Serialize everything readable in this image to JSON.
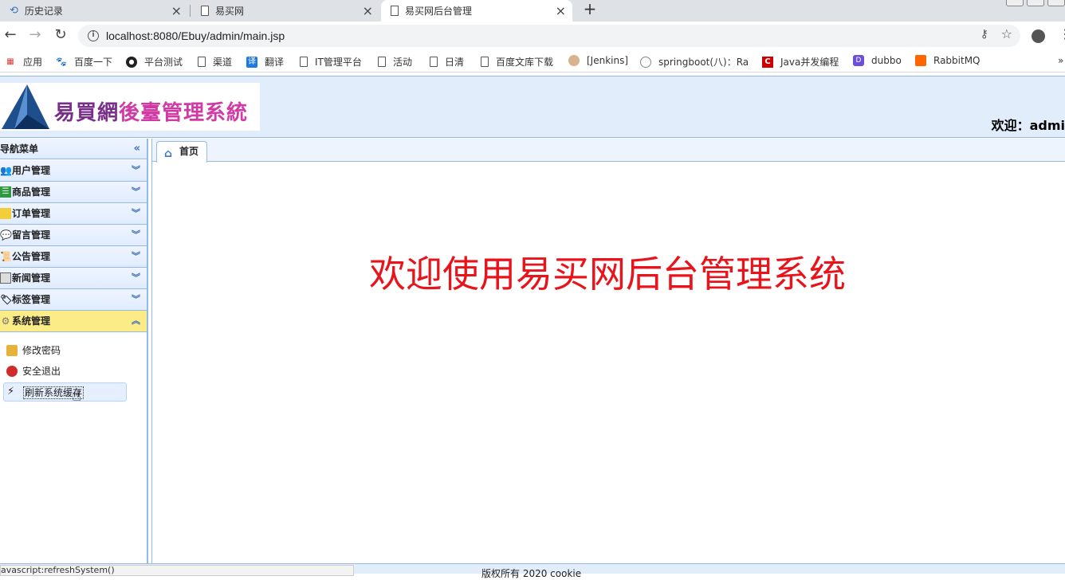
{
  "browser": {
    "tabs": [
      {
        "title": "历史记录",
        "icon": "history-icon"
      },
      {
        "title": "易买网",
        "icon": "document-icon"
      },
      {
        "title": "易买网后台管理",
        "icon": "document-icon",
        "active": true
      }
    ],
    "url": "localhost:8080/Ebuy/admin/main.jsp",
    "bookmarks": [
      {
        "label": "应用",
        "icon": "apps-icon"
      },
      {
        "label": "百度一下",
        "icon": "baidu-icon"
      },
      {
        "label": "平台测试",
        "icon": "platform-icon"
      },
      {
        "label": "渠道",
        "icon": "document-icon"
      },
      {
        "label": "翻译",
        "icon": "translate-icon"
      },
      {
        "label": "IT管理平台",
        "icon": "document-icon"
      },
      {
        "label": "活动",
        "icon": "document-icon"
      },
      {
        "label": "日清",
        "icon": "document-icon"
      },
      {
        "label": "百度文库下载",
        "icon": "document-icon"
      },
      {
        "label": "[Jenkins]",
        "icon": "jenkins-icon"
      },
      {
        "label": "springboot(八)：Ra",
        "icon": "springboot-icon"
      },
      {
        "label": "Java并发编程",
        "icon": "csdn-icon"
      },
      {
        "label": "dubbo",
        "icon": "dubbo-icon"
      },
      {
        "label": "RabbitMQ",
        "icon": "rabbitmq-icon"
      }
    ],
    "bookmarks_overflow": "»",
    "status_url": "avascript:refreshSystem()"
  },
  "header": {
    "logo_part1": "易買網",
    "logo_part2": "後臺管理系統",
    "welcome": "欢迎：admi"
  },
  "sidebar": {
    "title": "导航菜单",
    "panels": [
      {
        "label": "用户管理",
        "icon": "users-icon"
      },
      {
        "label": "商品管理",
        "icon": "list-icon"
      },
      {
        "label": "订单管理",
        "icon": "folder-icon"
      },
      {
        "label": "留言管理",
        "icon": "comment-icon"
      },
      {
        "label": "公告管理",
        "icon": "notice-icon"
      },
      {
        "label": "新闻管理",
        "icon": "news-icon"
      },
      {
        "label": "标签管理",
        "icon": "tag-icon"
      },
      {
        "label": "系统管理",
        "icon": "gear-icon",
        "open": true
      }
    ],
    "sub_items": [
      {
        "label": "修改密码",
        "icon": "lock-icon"
      },
      {
        "label": "安全退出",
        "icon": "exit-icon"
      },
      {
        "label": "刷新系统缓存",
        "icon": "refresh-icon",
        "hover": true
      }
    ]
  },
  "main": {
    "home_tab": "首页",
    "welcome_message": "欢迎使用易买网后台管理系统"
  },
  "footer": {
    "copyright": "版权所有 2020 cookie"
  }
}
